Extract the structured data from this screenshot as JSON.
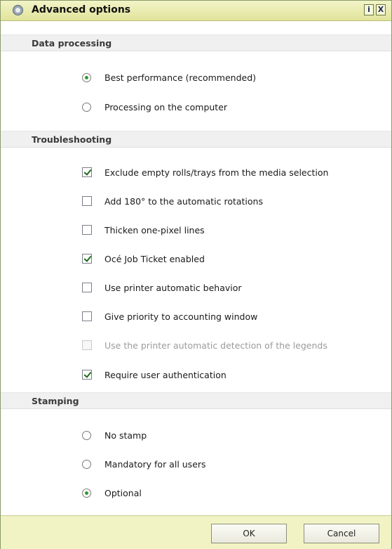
{
  "dialog": {
    "title": "Advanced options",
    "info_label": "i",
    "close_label": "X"
  },
  "sections": {
    "data_processing": "Data processing",
    "troubleshooting": "Troubleshooting",
    "stamping": "Stamping"
  },
  "data_processing": {
    "best_performance": {
      "label": "Best performance (recommended)",
      "selected": true
    },
    "processing_on_computer": {
      "label": "Processing on the computer",
      "selected": false
    }
  },
  "troubleshooting": {
    "exclude_empty_rolls": {
      "label": "Exclude empty rolls/trays from the media selection",
      "checked": true
    },
    "add_180": {
      "label": "Add 180° to the automatic rotations",
      "checked": false
    },
    "thicken_lines": {
      "label": "Thicken one-pixel lines",
      "checked": false
    },
    "oce_job_ticket": {
      "label": "Océ Job Ticket enabled",
      "checked": true
    },
    "printer_auto_behavior": {
      "label": "Use printer automatic behavior",
      "checked": false
    },
    "priority_accounting": {
      "label": "Give priority to accounting window",
      "checked": false
    },
    "auto_detect_legends": {
      "label": "Use the printer automatic detection of the legends",
      "checked": false,
      "disabled": true
    },
    "require_auth": {
      "label": "Require user authentication",
      "checked": true
    }
  },
  "stamping": {
    "no_stamp": {
      "label": "No stamp",
      "selected": false
    },
    "mandatory": {
      "label": "Mandatory for all users",
      "selected": false
    },
    "optional": {
      "label": "Optional",
      "selected": true
    }
  },
  "footer": {
    "ok_label": "OK",
    "cancel_label": "Cancel"
  },
  "colors": {
    "titlebar": "#e1e49a",
    "section_bg": "#f0f0f0",
    "footer_bg": "#f1f3c4",
    "radio_selected": "#2f9a2f"
  }
}
